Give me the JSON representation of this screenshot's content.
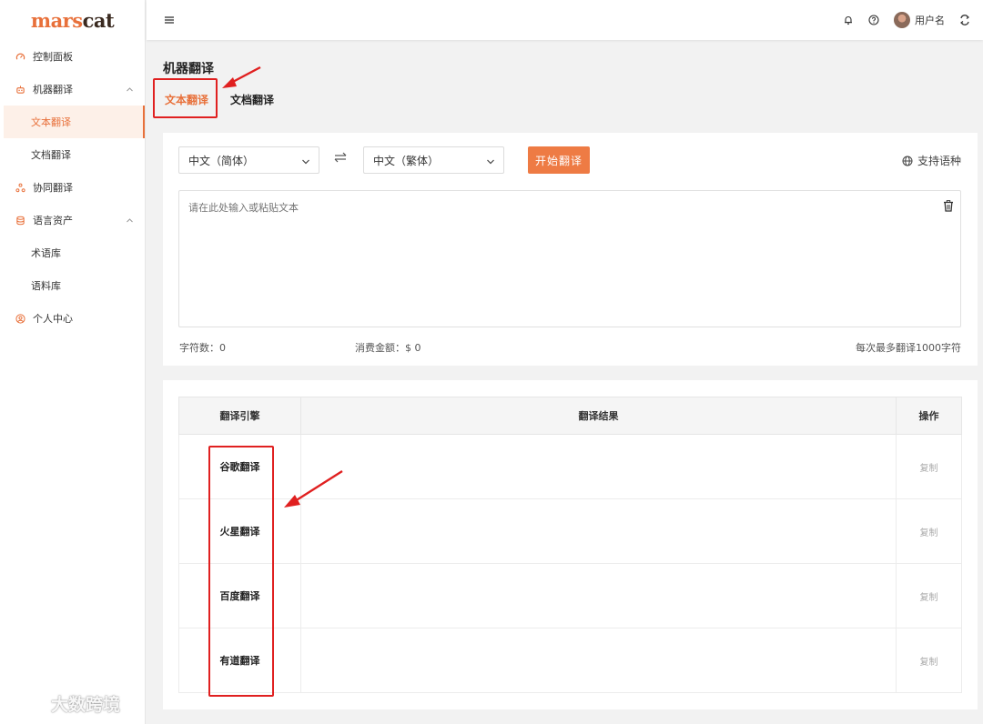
{
  "brand": {
    "logo_a": "mars",
    "logo_b": "cat"
  },
  "sidebar": {
    "items": [
      {
        "label": "控制面板",
        "icon": "dashboard-icon"
      },
      {
        "label": "机器翻译",
        "icon": "robot-icon",
        "expanded": true,
        "children": [
          {
            "label": "文本翻译",
            "active": true
          },
          {
            "label": "文档翻译"
          }
        ]
      },
      {
        "label": "协同翻译",
        "icon": "collab-icon"
      },
      {
        "label": "语言资产",
        "icon": "database-icon",
        "expanded": true,
        "children": [
          {
            "label": "术语库"
          },
          {
            "label": "语料库"
          }
        ]
      },
      {
        "label": "个人中心",
        "icon": "user-icon"
      }
    ]
  },
  "header": {
    "username": "用户名"
  },
  "page": {
    "title": "机器翻译",
    "tabs": [
      {
        "label": "文本翻译",
        "active": true
      },
      {
        "label": "文档翻译"
      }
    ]
  },
  "translate": {
    "source_lang": "中文（简体）",
    "target_lang": "中文（繁体）",
    "start_button": "开始翻译",
    "support_label": "支持语种",
    "placeholder": "请在此处输入或粘贴文本",
    "char_count_label": "字符数：",
    "char_count": "0",
    "cost_label": "消费金额：",
    "cost": "$ 0",
    "limit_note": "每次最多翻译1000字符"
  },
  "results": {
    "headers": {
      "engine": "翻译引擎",
      "result": "翻译结果",
      "action": "操作"
    },
    "rows": [
      {
        "engine": "谷歌翻译",
        "result": "",
        "action": "复制"
      },
      {
        "engine": "火星翻译",
        "result": "",
        "action": "复制"
      },
      {
        "engine": "百度翻译",
        "result": "",
        "action": "复制"
      },
      {
        "engine": "有道翻译",
        "result": "",
        "action": "复制"
      }
    ]
  },
  "watermark": "大数跨境",
  "colors": {
    "accent": "#ee7b44",
    "annotation": "#e02020"
  }
}
